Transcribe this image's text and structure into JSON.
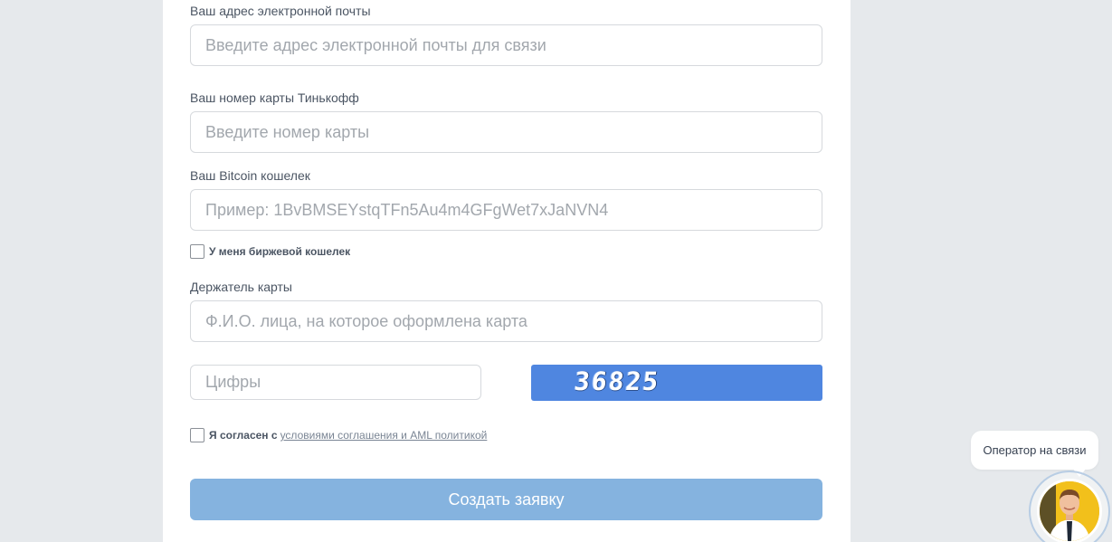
{
  "form": {
    "email": {
      "label": "Ваш адрес электронной почты",
      "placeholder": "Введите адрес электронной почты для связи"
    },
    "card_number": {
      "label": "Ваш номер карты Тинькофф",
      "placeholder": "Введите номер карты"
    },
    "bitcoin_wallet": {
      "label": "Ваш Bitcoin кошелек",
      "placeholder": "Пример: 1BvBMSEYstqTFn5Au4m4GFgWet7xJaNVN4"
    },
    "exchange_wallet_checkbox": {
      "label": "У меня биржевой кошелек"
    },
    "card_holder": {
      "label": "Держатель карты",
      "placeholder": "Ф.И.О. лица, на которое оформлена карта"
    },
    "captcha": {
      "placeholder": "Цифры",
      "code": "36825"
    },
    "agreement": {
      "text": "Я согласен с",
      "link": "условиями соглашения и AML политикой"
    },
    "submit_label": "Создать заявку"
  },
  "chat_widget": {
    "bubble_text": "Оператор на связи"
  },
  "colors": {
    "page_bg": "#e6e9ec",
    "captcha_bg": "#4f86e0",
    "submit_bg": "#85b3df"
  }
}
